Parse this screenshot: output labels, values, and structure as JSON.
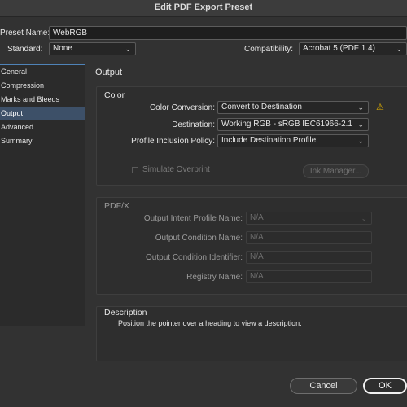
{
  "window": {
    "title": "Edit PDF Export Preset"
  },
  "preset": {
    "name_label": "Preset Name:",
    "name_value": "WebRGB",
    "standard_label": "Standard:",
    "standard_value": "None",
    "compat_label": "Compatibility:",
    "compat_value": "Acrobat 5 (PDF 1.4)"
  },
  "sidebar": {
    "items": [
      {
        "label": "General"
      },
      {
        "label": "Compression"
      },
      {
        "label": "Marks and Bleeds"
      },
      {
        "label": "Output",
        "selected": true
      },
      {
        "label": "Advanced"
      },
      {
        "label": "Summary"
      }
    ]
  },
  "panel": {
    "heading": "Output",
    "color": {
      "title": "Color",
      "conversion_label": "Color Conversion:",
      "conversion_value": "Convert to Destination",
      "destination_label": "Destination:",
      "destination_value": "Working RGB - sRGB IEC61966-2.1",
      "profile_label": "Profile Inclusion Policy:",
      "profile_value": "Include Destination Profile",
      "simulate_label": "Simulate Overprint",
      "ink_manager_label": "Ink Manager..."
    },
    "pdfx": {
      "title": "PDF/X",
      "intent_label": "Output Intent Profile Name:",
      "intent_value": "N/A",
      "condition_label": "Output Condition Name:",
      "condition_value": "N/A",
      "identifier_label": "Output Condition Identifier:",
      "identifier_value": "N/A",
      "registry_label": "Registry Name:",
      "registry_value": "N/A"
    },
    "description": {
      "title": "Description",
      "text": "Position the pointer over a heading to view a description."
    }
  },
  "footer": {
    "cancel_label": "Cancel",
    "ok_label": "OK"
  },
  "colors": {
    "accent": "#4f83b8",
    "warning": "#e5b300",
    "background": "#323232"
  },
  "icons": {
    "warning": "warning-icon",
    "chevron": "chevron-down-icon"
  }
}
